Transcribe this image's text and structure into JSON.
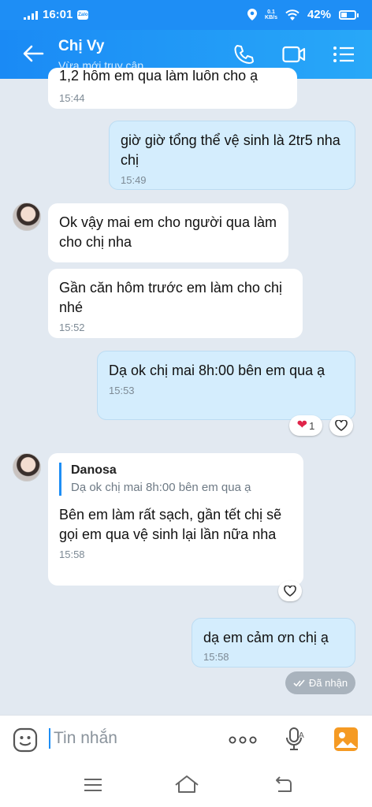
{
  "status_bar": {
    "time": "16:01",
    "speed_value": "0.1",
    "speed_unit": "KB/s",
    "battery": "42%",
    "app_badge": "Zalo"
  },
  "header": {
    "contact_name": "Chị Vy",
    "status": "Vừa mới truy cập"
  },
  "messages": [
    {
      "direction": "in",
      "text": "1,2 hôm em qua làm luôn cho ạ",
      "time": "15:44"
    },
    {
      "direction": "out",
      "text": "giờ giờ tổng thể vệ sinh là 2tr5 nha chị",
      "time": "15:49"
    },
    {
      "direction": "in",
      "text": "Ok vậy mai em cho người qua làm cho chị nha",
      "time": ""
    },
    {
      "direction": "in",
      "text": "Gần căn hôm trước em làm cho chị nhé",
      "time": "15:52"
    },
    {
      "direction": "out",
      "text": "Dạ ok chị mai 8h:00 bên em qua ạ",
      "time": "15:53",
      "reaction_count": "1"
    },
    {
      "direction": "in",
      "quote_name": "Danosa",
      "quote_text": "Dạ ok chị mai 8h:00 bên em qua ạ",
      "text": "Bên em làm rất sạch, gần tết chị sẽ gọi em qua vệ sinh lại lần nữa nha",
      "time": "15:58"
    },
    {
      "direction": "out",
      "text": "dạ em cảm ơn chị ạ",
      "time": "15:58"
    }
  ],
  "delivery_status": "Đã nhận",
  "composer": {
    "placeholder": "Tin nhắn"
  },
  "colors": {
    "header": "#1e8ef5",
    "outgoing_bubble": "#d4edfd",
    "incoming_bubble": "#ffffff",
    "background": "#e2e9f1",
    "reaction_heart": "#e0254a"
  }
}
